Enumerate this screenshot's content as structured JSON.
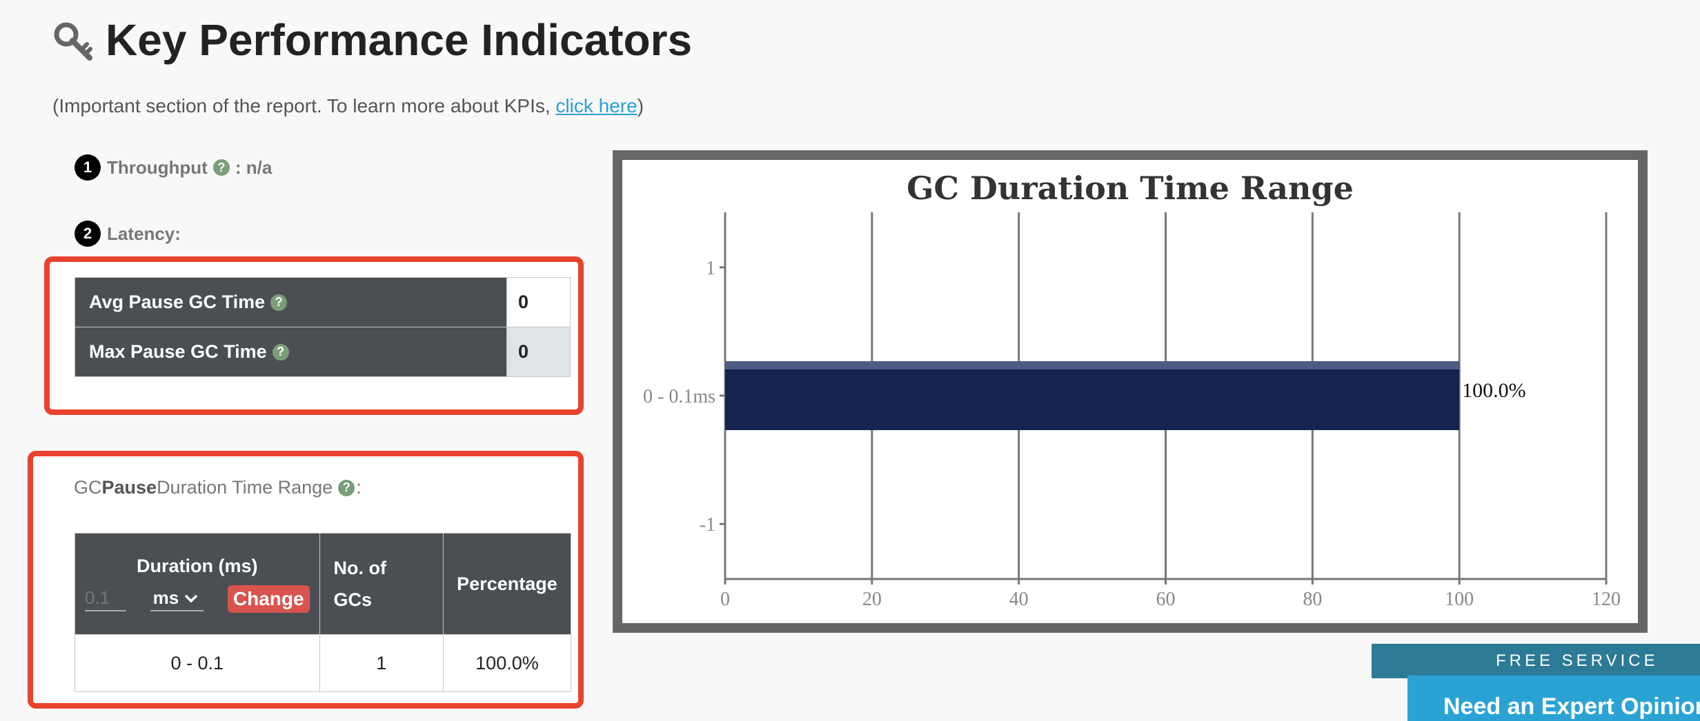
{
  "header": {
    "title": "Key Performance Indicators",
    "subtitle_prefix": "(Important section of the report. To learn more about KPIs, ",
    "subtitle_link": "click here",
    "subtitle_suffix": ")"
  },
  "kpi": {
    "throughput": {
      "number": "1",
      "label": "Throughput",
      "value": ": n/a"
    },
    "latency": {
      "number": "2",
      "label": "Latency:"
    }
  },
  "latency_table": {
    "rows": [
      {
        "label": "Avg Pause GC Time",
        "value": "0"
      },
      {
        "label": "Max Pause GC Time",
        "value": "0"
      }
    ]
  },
  "pause_section": {
    "caption_prefix": "GC ",
    "caption_bold": "Pause",
    "caption_suffix": " Duration Time Range",
    "caption_end": ":",
    "headers": {
      "duration": "Duration (ms)",
      "gcs": "No. of GCs",
      "percentage": "Percentage"
    },
    "duration_placeholder": "0.1",
    "unit": "ms",
    "change_label": "Change",
    "rows": [
      {
        "range": "0 - 0.1",
        "gcs": "1",
        "percentage": "100.0%"
      }
    ]
  },
  "chart_data": {
    "type": "bar",
    "orientation": "horizontal",
    "title": "GC Duration Time Range",
    "categories": [
      "0 - 0.1ms"
    ],
    "values": [
      100.0
    ],
    "data_labels": [
      "100.0%"
    ],
    "x_ticks": [
      "0",
      "20",
      "40",
      "60",
      "80",
      "100",
      "120"
    ],
    "xlim": [
      0,
      120
    ],
    "y_ticks": [
      "1",
      "0 - 0.1ms",
      "-1"
    ],
    "grid": true,
    "bar_color": "#142350"
  },
  "banner": {
    "free_service": "FREE SERVICE",
    "expert": "Need an Expert Opinion?"
  },
  "colors": {
    "accent_red": "#e8432d",
    "header_dark": "#4b4f54",
    "link": "#2a9fd6",
    "change_button": "#d9534f"
  }
}
